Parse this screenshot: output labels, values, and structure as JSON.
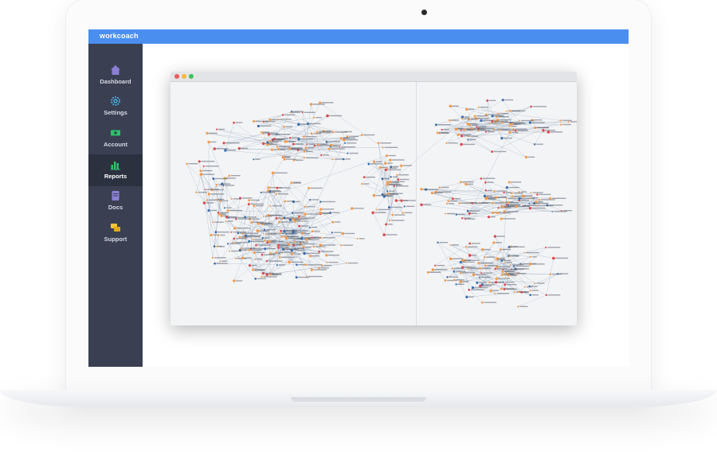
{
  "app": {
    "brand": "workcoach"
  },
  "sidebar": {
    "items": [
      {
        "label": "Dashboard",
        "icon": "home-icon",
        "color": "#8b7fd4",
        "active": false
      },
      {
        "label": "Settings",
        "icon": "gear-icon",
        "color": "#4bb3ea",
        "active": false
      },
      {
        "label": "Account",
        "icon": "money-icon",
        "color": "#2bc46a",
        "active": false
      },
      {
        "label": "Reports",
        "icon": "bar-chart-icon",
        "color": "#2bc46a",
        "active": true
      },
      {
        "label": "Docs",
        "icon": "document-icon",
        "color": "#8b7fd4",
        "active": false
      },
      {
        "label": "Support",
        "icon": "chat-icon",
        "color": "#f3c533",
        "active": false
      }
    ]
  },
  "colors": {
    "topbar": "#4a8ef0",
    "sidebar": "#3a4052",
    "sidebar_active": "#2c3140",
    "window_bg": "#f3f4f6",
    "node_orange": "#f39a4a",
    "node_red": "#e0474c",
    "node_blue": "#3b6fb0",
    "edge": "#8fa3b8",
    "dot_close": "#ef5b5b",
    "dot_min": "#f5b83d",
    "dot_max": "#3cc45a"
  }
}
